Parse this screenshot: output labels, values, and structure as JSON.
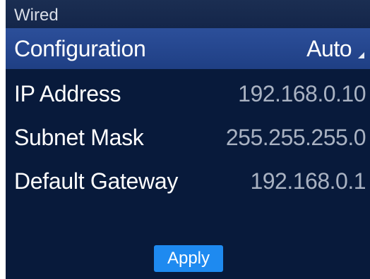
{
  "header": {
    "title": "Wired"
  },
  "rows": [
    {
      "label": "Configuration",
      "value": "Auto"
    },
    {
      "label": "IP Address",
      "value": "192.168.0.10"
    },
    {
      "label": "Subnet Mask",
      "value": "255.255.255.0"
    },
    {
      "label": "Default Gateway",
      "value": "192.168.0.1"
    }
  ],
  "actions": {
    "apply_label": "Apply"
  },
  "colors": {
    "background": "#081a3b",
    "header": "#16284c",
    "selected_row": "#254892",
    "button": "#1e8af0",
    "value_text": "#a9b2c2"
  },
  "icons": {
    "dropdown": "dropdown-corner-icon"
  }
}
